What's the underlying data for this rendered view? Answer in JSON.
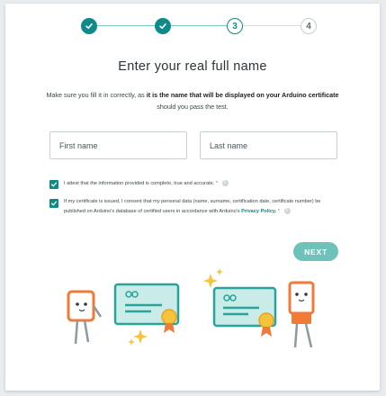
{
  "stepper": {
    "step3_label": "3",
    "step4_label": "4",
    "colors": {
      "done": "#0f8a88",
      "line_done": "#7fc9c2",
      "line_todo": "#d6dcdd"
    }
  },
  "form": {
    "title": "Enter your real full name",
    "subtitle_prefix": "Make sure you fill it in correctly, as ",
    "subtitle_bold": "it is the name that will be displayed on your Arduino certificate",
    "subtitle_suffix": " should you pass the test.",
    "first_name_placeholder": "First name",
    "last_name_placeholder": "Last name",
    "first_name_value": "",
    "last_name_value": ""
  },
  "consents": {
    "attest_text": "I attest that the information provided is complete, true and accurate.",
    "attest_required": "*",
    "privacy_text": "If my certificate is issued, I consent that my personal data (name, surname, certification date, certificate number) be published on Arduino's database of certified users in accordance with Arduino's ",
    "privacy_link": "Privacy Policy.",
    "privacy_required": "*",
    "info_glyph": "i"
  },
  "actions": {
    "next_label": "NEXT"
  },
  "icons": {
    "step_check": "check-icon",
    "checkbox": "checkbox-checked-icon",
    "info": "info-icon"
  },
  "theme": {
    "accent": "#0f8a88",
    "next_button": "#6fc2bb",
    "orange": "#f07a38",
    "yellow": "#f6c33c"
  }
}
